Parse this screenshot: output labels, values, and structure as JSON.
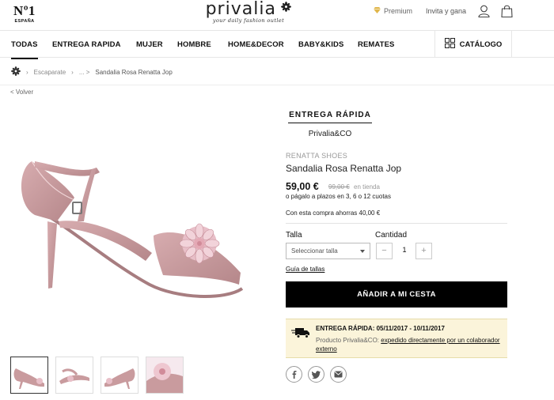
{
  "header": {
    "badge_big": "Nº1",
    "badge_small": "ESPAÑA",
    "logo_text": "privalia",
    "logo_tagline": "your daily fashion outlet",
    "premium_label": "Premium",
    "invite_label": "Invita y gana",
    "icons": [
      "gem-icon",
      "user-icon",
      "shopping-bag-icon"
    ]
  },
  "nav": {
    "items": [
      {
        "label": "TODAS",
        "active": true
      },
      {
        "label": "ENTREGA RAPIDA"
      },
      {
        "label": "MUJER"
      },
      {
        "label": "HOMBRE"
      },
      {
        "label": "HOME&DECOR"
      },
      {
        "label": "BABY&KIDS"
      },
      {
        "label": "REMATES"
      }
    ],
    "catalog_label": "CATÁLOGO"
  },
  "breadcrumb": {
    "home_icon": "flower-icon",
    "items": [
      "Escaparate",
      "... >",
      "Sandalia Rosa Renatta Jop"
    ],
    "back_label": "< Volver"
  },
  "product": {
    "campaign_title": "ENTREGA RÁPIDA",
    "campaign_sub": "Privalia&CO",
    "brand": "RENATTA SHOES",
    "name": "Sandalia Rosa Renatta Jop",
    "price": "59,00 €",
    "old_price": "99,00 €",
    "old_price_label": "en tienda",
    "installments": "o págalo a plazos en 3, 6 o 12 cuotas",
    "savings": "Con esta compra ahorras 40,00 €",
    "size_label": "Talla",
    "size_placeholder": "Seleccionar talla",
    "qty_label": "Cantidad",
    "qty_value": "1",
    "qty_minus": "−",
    "qty_plus": "+",
    "size_guide": "Guía de tallas",
    "add_to_cart": "AÑADIR A MI CESTA",
    "thumbnail_count": 4
  },
  "delivery": {
    "title": "ENTREGA RÁPIDA: 05/11/2017 - 10/11/2017",
    "text_prefix": "Producto Privalia&CO:",
    "link_text": "expedido directamente por un colaborador externo"
  },
  "share": [
    "facebook-icon",
    "twitter-icon",
    "email-icon"
  ],
  "colors": {
    "accent": "#000000",
    "delivery_bg": "#fbf4da",
    "shoe_pink": "#c99b9e"
  }
}
